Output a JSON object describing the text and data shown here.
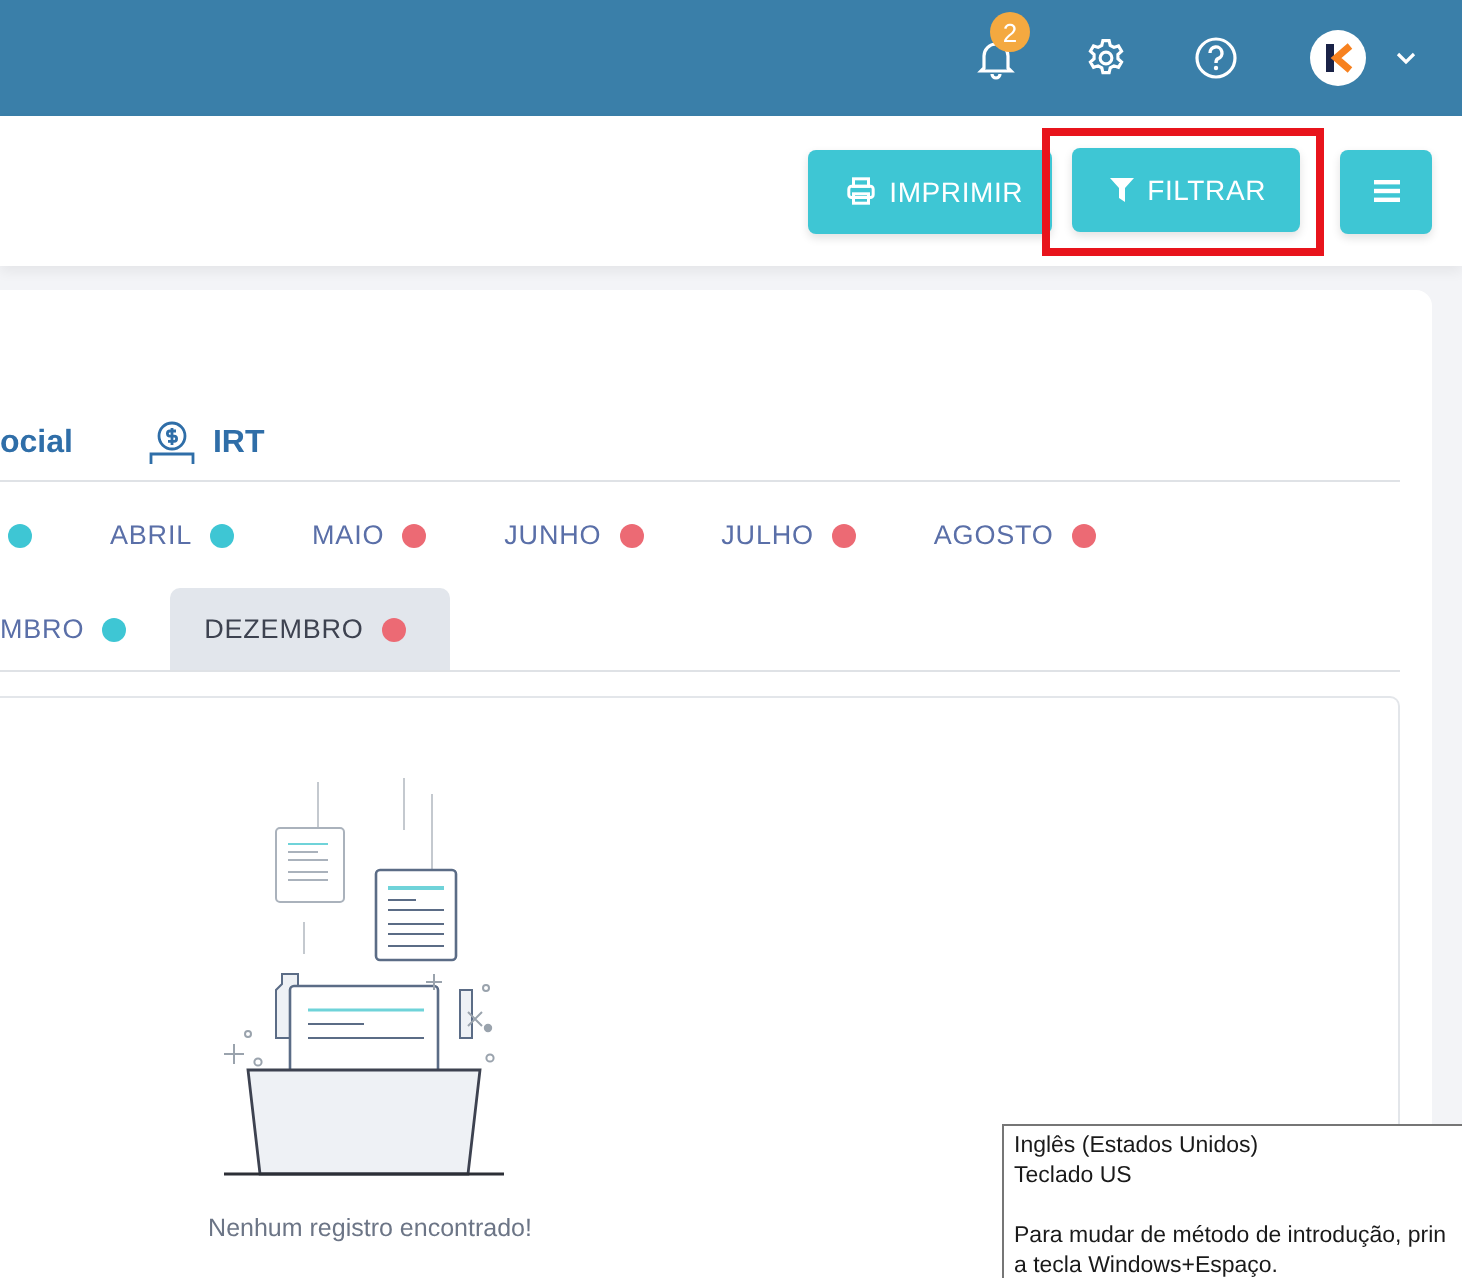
{
  "topbar": {
    "notification_count": "2"
  },
  "toolbar": {
    "buttons": [
      {
        "kind": "print",
        "label": "IMPRIMIR",
        "highlighted": false
      },
      {
        "kind": "filter",
        "label": "FILTRAR",
        "highlighted": true
      },
      {
        "kind": "menu",
        "highlighted": false
      }
    ]
  },
  "tabs": [
    {
      "kind": "plain",
      "label": "ocial"
    },
    {
      "kind": "money",
      "label": "IRT"
    }
  ],
  "months": {
    "rows": [
      {
        "items": [
          {
            "color": "#3ec6d4",
            "selected": false
          },
          {
            "label": "ABRIL",
            "color": "#3ec6d4",
            "selected": false
          },
          {
            "label": "MAIO",
            "color": "#ec6a74",
            "selected": false
          },
          {
            "label": "JUNHO",
            "color": "#ec6a74",
            "selected": false
          },
          {
            "label": "JULHO",
            "color": "#ec6a74",
            "selected": false
          },
          {
            "label": "AGOSTO",
            "color": "#ec6a74",
            "selected": false
          }
        ]
      },
      {
        "items": [
          {
            "label": "MBRO",
            "color": "#3ec6d4",
            "selected": false
          },
          {
            "label": "DEZEMBRO",
            "color": "#ec6a74",
            "selected": true
          }
        ]
      }
    ]
  },
  "empty_state": {
    "message": "Nenhum registro encontrado!"
  },
  "tooltip": {
    "lines": [
      "Inglês (Estados Unidos)",
      "Teclado US"
    ],
    "hint_lines": [
      "Para mudar de método de introdução, prin",
      "a tecla Windows+Espaço."
    ]
  }
}
